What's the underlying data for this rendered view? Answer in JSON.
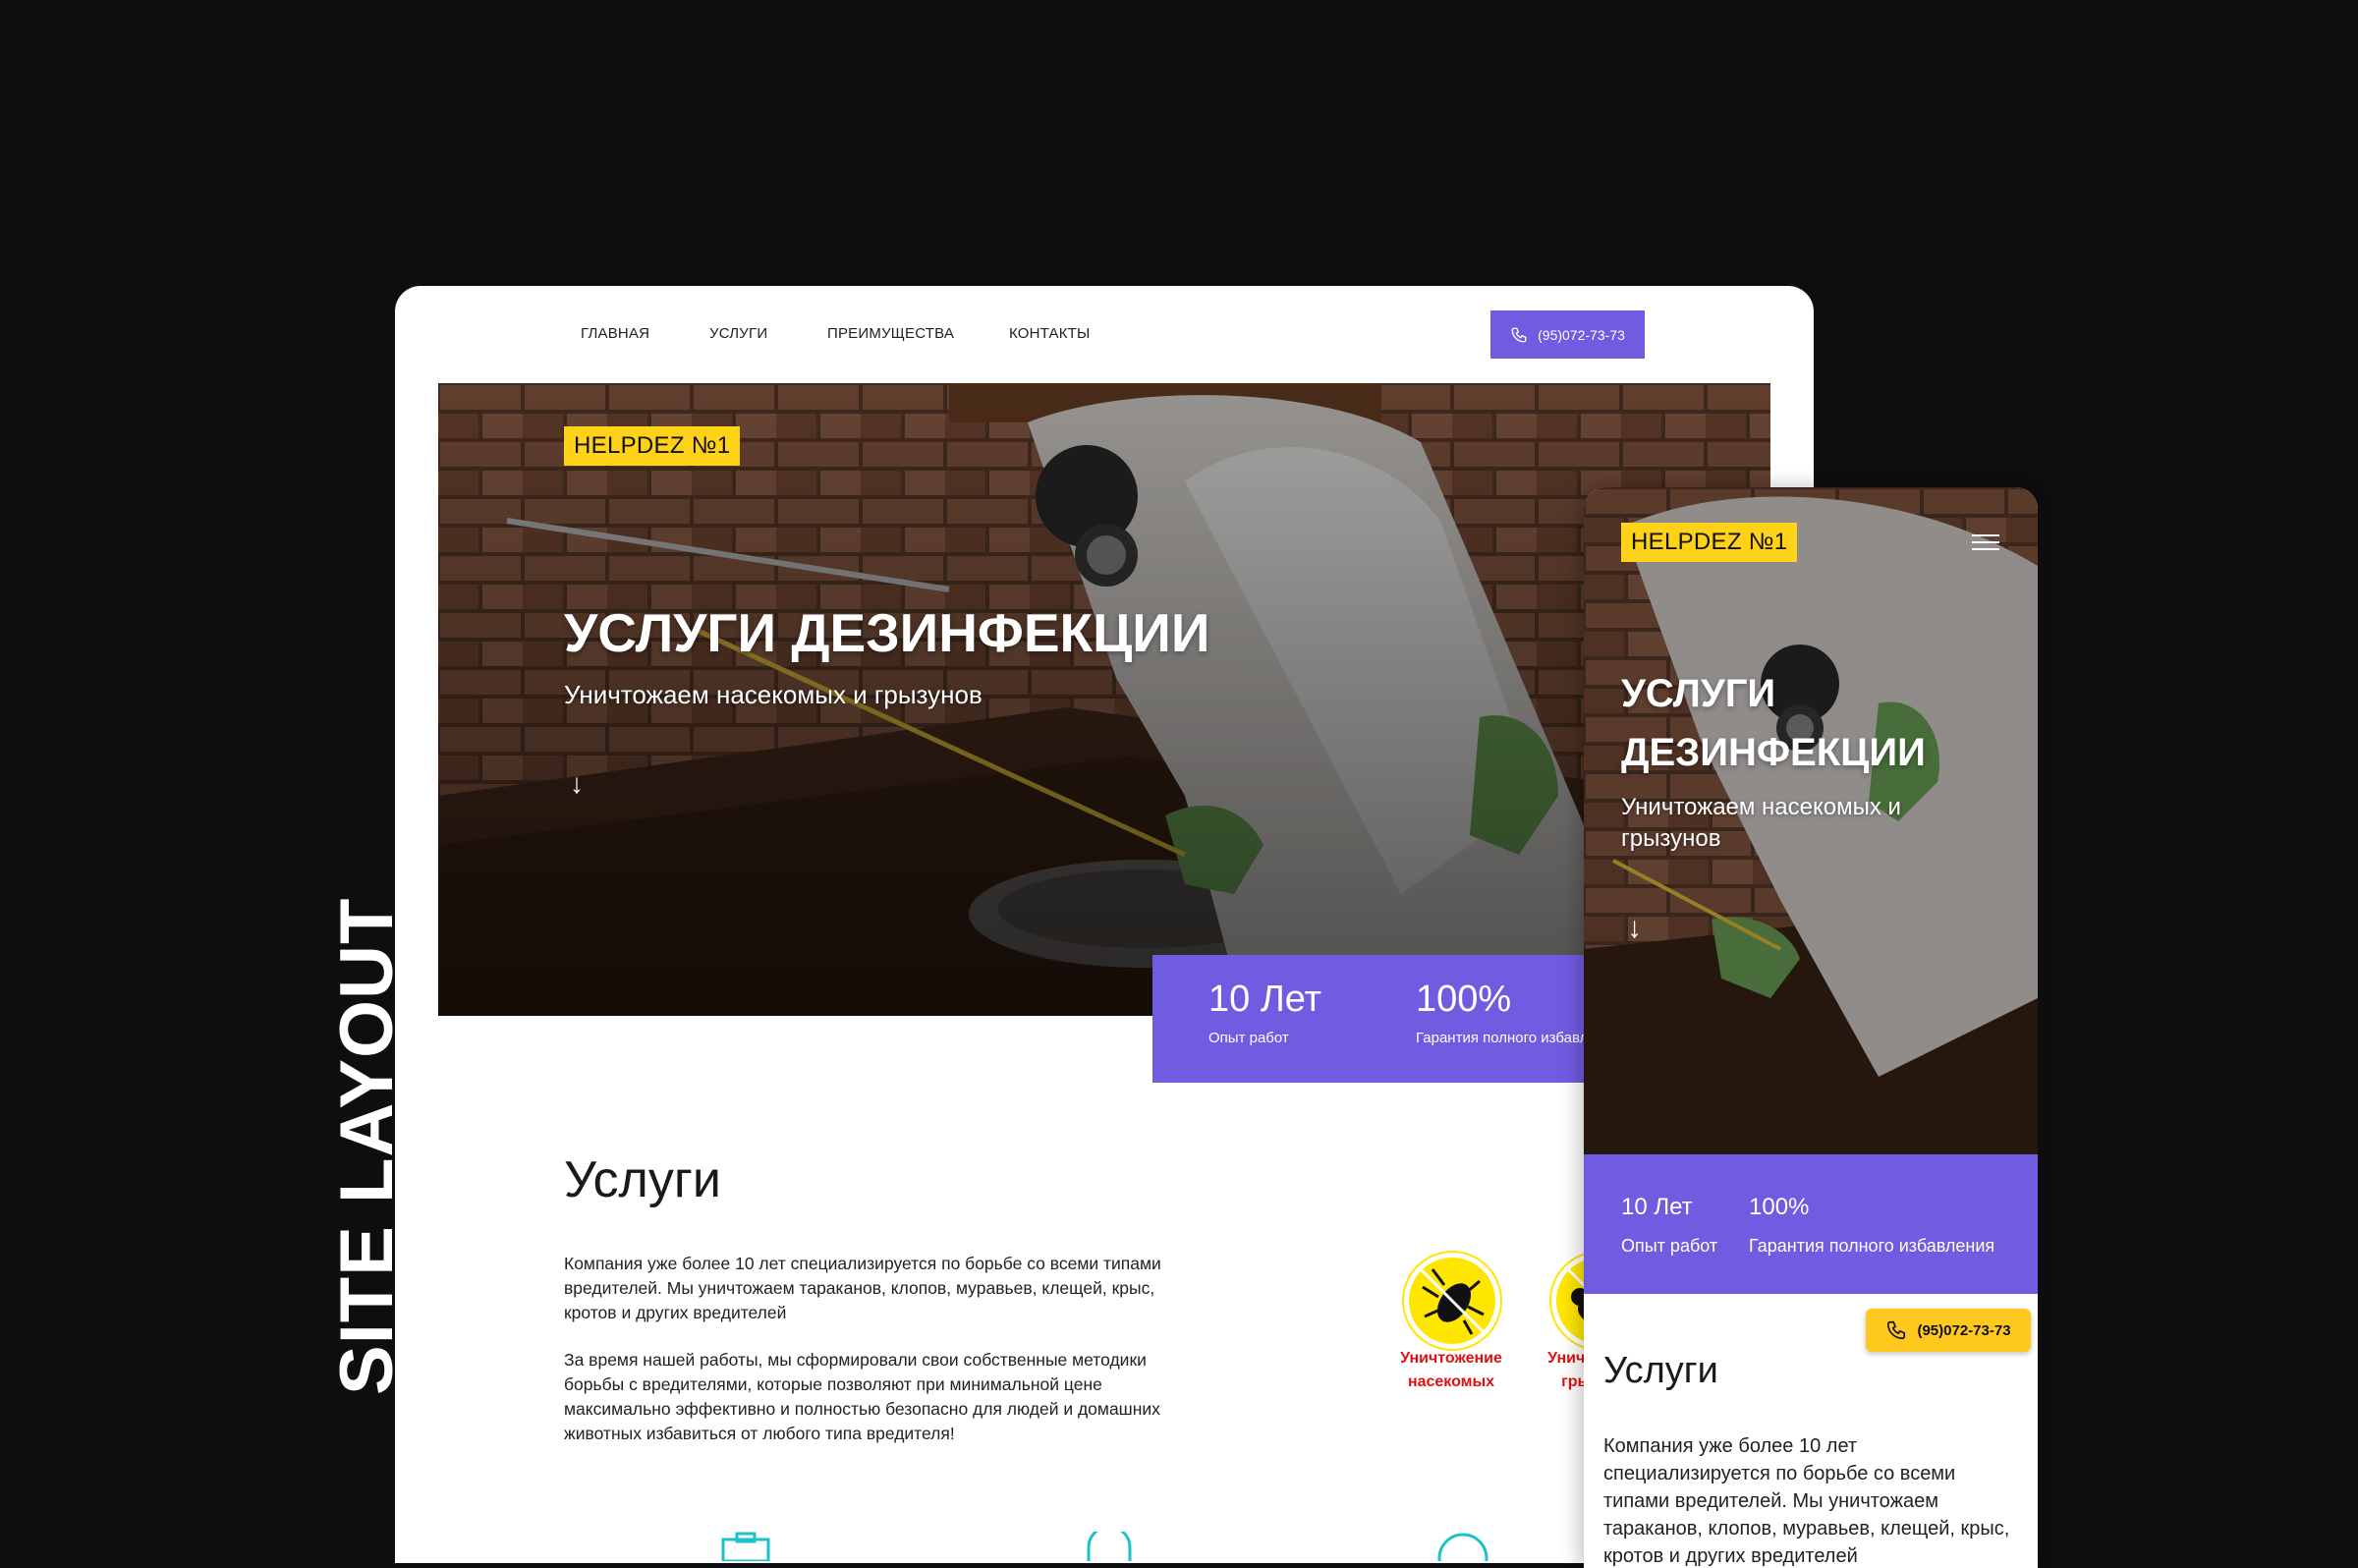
{
  "side_label": "SITE LAYOUT",
  "desktop": {
    "nav": {
      "items": [
        {
          "label": "ГЛАВНАЯ"
        },
        {
          "label": "УСЛУГИ"
        },
        {
          "label": "ПРЕИМУЩЕСТВА"
        },
        {
          "label": "КОНТАКТЫ"
        }
      ],
      "phone": "(95)072-73-73"
    },
    "hero": {
      "badge": "HELPDEZ №1",
      "title": "УСЛУГИ ДЕЗИНФЕКЦИИ",
      "subtitle": "Уничтожаем насекомых и грызунов",
      "arrow": "↓"
    },
    "stats": [
      {
        "value": "10 Лет",
        "label": "Опыт работ"
      },
      {
        "value": "100%",
        "label": "Гарантия полного избавления"
      }
    ],
    "services": {
      "title": "Услуги",
      "paragraph1": "Компания уже более 10 лет специализируется по борьбе со всеми типами вредителей. Мы уничтожаем тараканов, клопов, муравьев, клещей, крыс, кротов и других вредителей",
      "paragraph2": "За время нашей работы, мы сформировали свои собственные методики борьбы с вредителями, которые позволяют при минимальной цене максимально эффективно и полностью безопасно для людей и домашних животных избавиться от любого типа вредителя!",
      "cards": [
        {
          "label_line1": "Уничтожение",
          "label_line2": "насекомых",
          "icon": "bug-icon"
        },
        {
          "label_line1": "Уничтожение",
          "label_line2": "грызунов",
          "icon": "rodent-icon"
        }
      ]
    }
  },
  "mobile": {
    "badge": "HELPDEZ №1",
    "title_line1": "УСЛУГИ",
    "title_line2": "ДЕЗИНФЕКЦИИ",
    "subtitle_line1": "Уничтожаем насекомых и",
    "subtitle_line2": "грызунов",
    "arrow": "↓",
    "stats": [
      {
        "value": "10 Лет",
        "label": "Опыт работ"
      },
      {
        "value": "100%",
        "label": "Гарантия полного избавления"
      }
    ],
    "phone": "(95)072-73-73",
    "services_title": "Услуги",
    "paragraph_lines": [
      "Компания уже более 10 лет",
      "специализируется по борьбе со всеми",
      "типами вредителей. Мы уничтожаем",
      "тараканов, клопов, муравьев, клещей, крыс,",
      "кротов и других вредителей"
    ]
  },
  "colors": {
    "accent_purple": "#6f5ce0",
    "badge_yellow": "#ffd21a",
    "label_red": "#e01010",
    "background": "#0e0e10"
  }
}
